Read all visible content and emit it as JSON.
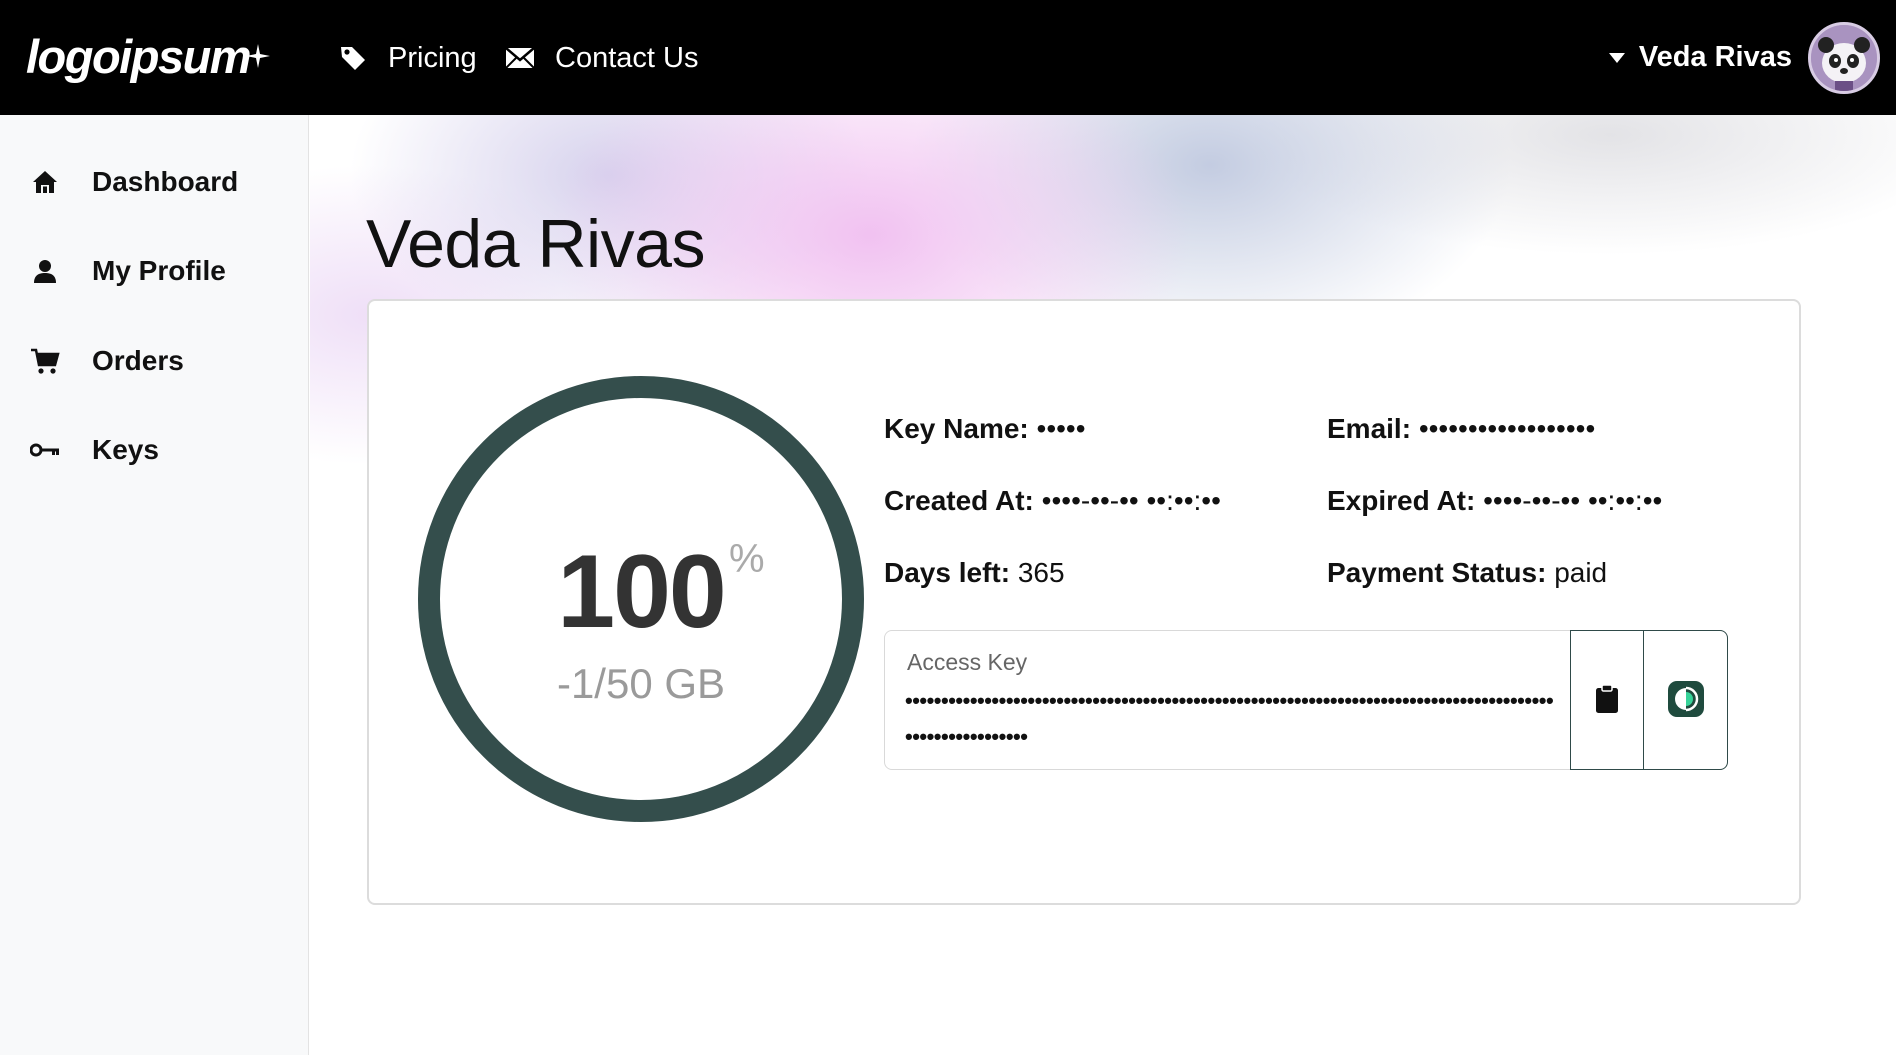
{
  "header": {
    "logo_text": "logoipsum",
    "nav": [
      {
        "label": "Pricing",
        "icon": "tag-icon"
      },
      {
        "label": "Contact Us",
        "icon": "envelope-icon"
      }
    ],
    "user": {
      "name": "Veda Rivas",
      "avatar": "panda-avatar"
    }
  },
  "sidebar": {
    "items": [
      {
        "label": "Dashboard",
        "icon": "home-icon"
      },
      {
        "label": "My Profile",
        "icon": "user-icon"
      },
      {
        "label": "Orders",
        "icon": "cart-icon"
      },
      {
        "label": "Keys",
        "icon": "key-icon"
      }
    ]
  },
  "main": {
    "title": "Veda Rivas",
    "usage": {
      "percent": "100",
      "percent_symbol": "%",
      "detail": "-1/50 GB",
      "ring_fraction": 1.0,
      "ring_color": "#344e4c"
    },
    "fields": {
      "key_name": {
        "label": "Key Name:",
        "value": "•••••"
      },
      "email": {
        "label": "Email:",
        "value": "••••••••••••••••••"
      },
      "created_at": {
        "label": "Created At:",
        "value": "••••-••-•• ••:••:••"
      },
      "expired_at": {
        "label": "Expired At:",
        "value": "••••-••-•• ••:••:••"
      },
      "days_left": {
        "label": "Days left:",
        "value": "365"
      },
      "payment_status": {
        "label": "Payment Status:",
        "value": "paid"
      }
    },
    "access_key": {
      "label": "Access Key",
      "value": "•••••••••••••••••••••••••••••••••••••••••••••••••••••••••••••••••••••••••••••••••••••••••••••••••••••••••••"
    }
  },
  "colors": {
    "header_bg": "#000000",
    "sidebar_bg": "#f8f9fa",
    "accent": "#344e4c"
  }
}
